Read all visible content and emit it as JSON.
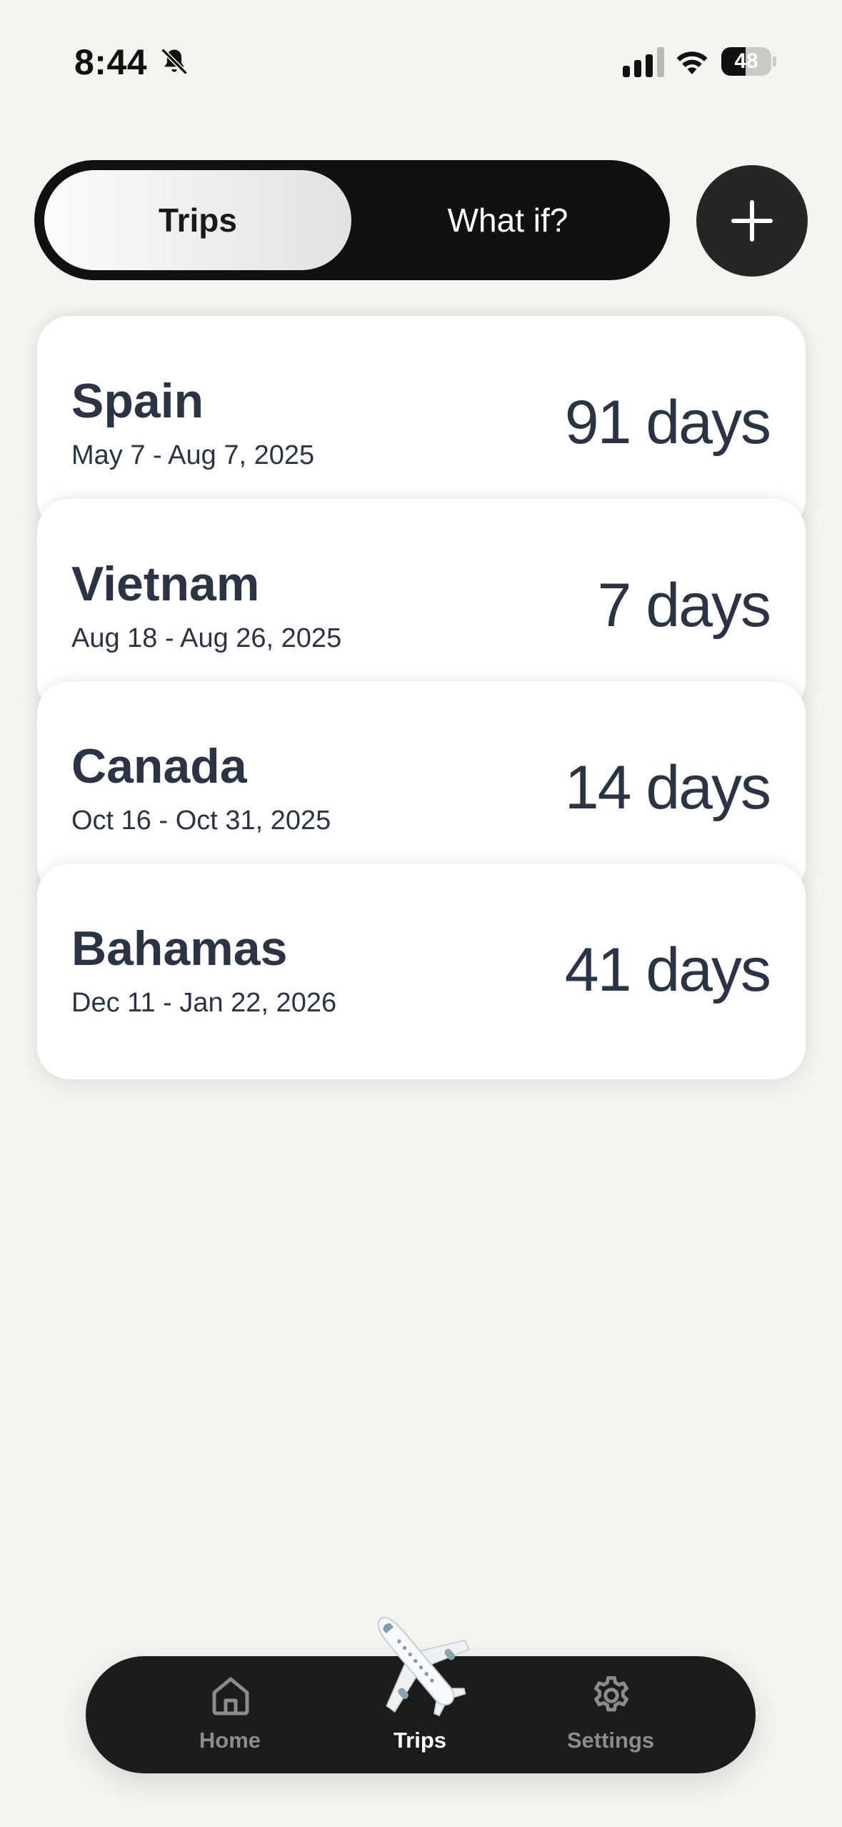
{
  "status_bar": {
    "time": "8:44",
    "battery_level": "48",
    "battery_fraction": 0.48
  },
  "segmented": {
    "trips_label": "Trips",
    "whatif_label": "What if?"
  },
  "trips": [
    {
      "name": "Spain",
      "dates": "May 7 - Aug 7, 2025",
      "days": "91 days"
    },
    {
      "name": "Vietnam",
      "dates": "Aug 18 - Aug 26, 2025",
      "days": "7 days"
    },
    {
      "name": "Canada",
      "dates": "Oct 16 - Oct 31, 2025",
      "days": "14 days"
    },
    {
      "name": "Bahamas",
      "dates": "Dec 11 - Jan 22, 2026",
      "days": "41 days"
    }
  ],
  "tab_bar": {
    "home_label": "Home",
    "trips_label": "Trips",
    "settings_label": "Settings",
    "active_tab": "Trips"
  },
  "icons": {
    "status": [
      "bell-slash-icon",
      "signal-icon",
      "wifi-icon",
      "battery-icon"
    ],
    "add": "plus-icon",
    "tabs": [
      "house-icon",
      "airplane-icon",
      "gear-icon"
    ]
  },
  "colors": {
    "background": "#f3f3ef",
    "segmented_bg": "#111111",
    "card_bg": "#ffffff",
    "text_primary": "#2b3445",
    "tab_bar_bg": "#1c1c1c",
    "tab_inactive": "#8c8c8c",
    "tab_active": "#ffffff"
  }
}
